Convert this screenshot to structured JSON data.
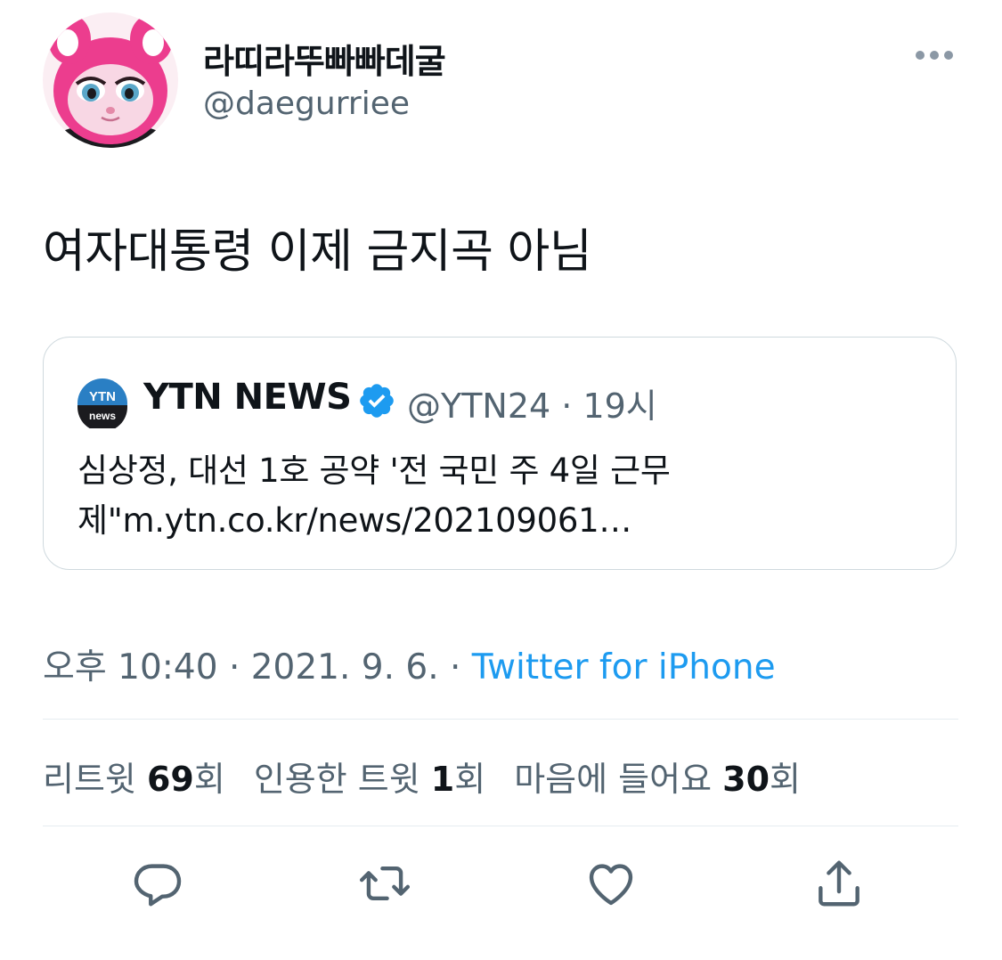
{
  "author": {
    "display_name": "라띠라뚜빠빠데굴",
    "handle": "@daegurriee",
    "avatar_icon": "pink-cat-avatar"
  },
  "tweet": {
    "text": "여자대통령 이제 금지곡 아님"
  },
  "quote": {
    "name": "YTN NEWS",
    "verified_icon": "verified-badge-icon",
    "handle_time": "@YTN24 · 19시",
    "text": "심상정, 대선 1호 공약 '전 국민 주 4일 근무제\"m.ytn.co.kr/news/202109061…",
    "avatar": {
      "top_text": "YTN",
      "bottom_text": "news"
    }
  },
  "meta": {
    "time_date": "오후 10:40 · 2021. 9. 6. · ",
    "source": "Twitter for iPhone"
  },
  "stats": {
    "retweets_label": "리트윗 ",
    "retweets_count": "69",
    "retweets_unit": "회",
    "quotes_label": "인용한 트윗 ",
    "quotes_count": "1",
    "quotes_unit": "회",
    "likes_label": "마음에 들어요 ",
    "likes_count": "30",
    "likes_unit": "회"
  },
  "colors": {
    "accent": "#1d9bf0",
    "muted": "#536471",
    "text": "#0f1419",
    "border": "#cfd9de"
  },
  "icons": {
    "more": "more-horizontal-icon",
    "reply": "reply-icon",
    "retweet": "retweet-icon",
    "like": "heart-icon",
    "share": "share-icon"
  }
}
